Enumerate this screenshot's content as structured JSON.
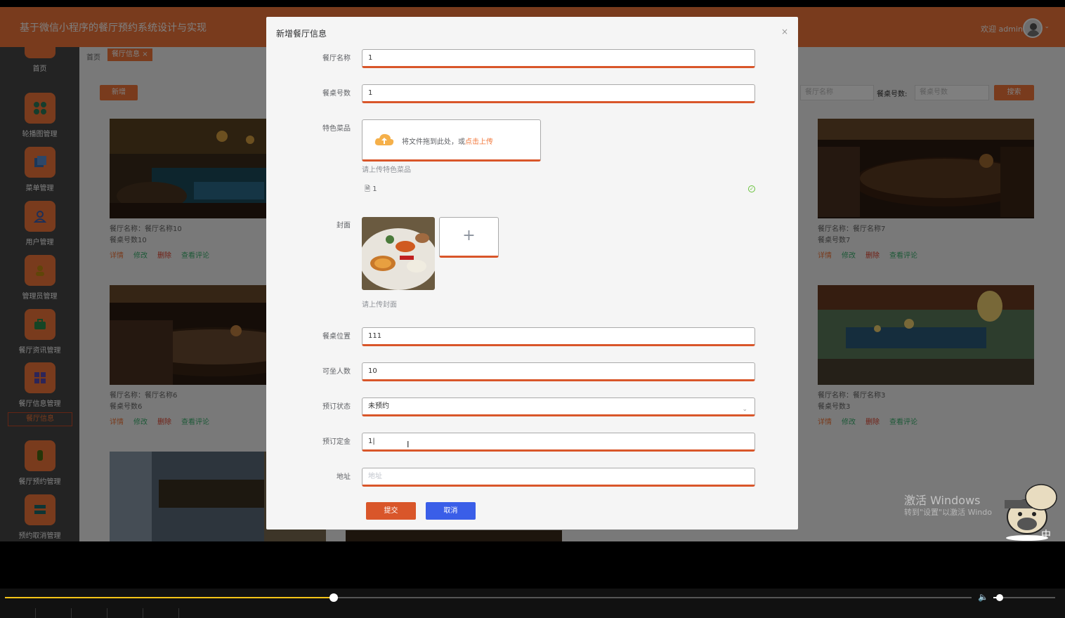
{
  "app": {
    "title": "基于微信小程序的餐厅预约系统设计与实现",
    "welcome": "欢迎 admin"
  },
  "sidebar": {
    "items": [
      {
        "label": "首页",
        "icon": "home-icon"
      },
      {
        "label": "轮播图管理",
        "icon": "grid-icon"
      },
      {
        "label": "菜单管理",
        "icon": "layers-icon"
      },
      {
        "label": "用户管理",
        "icon": "user-icon"
      },
      {
        "label": "管理员管理",
        "icon": "admin-icon"
      },
      {
        "label": "餐厅资讯管理",
        "icon": "briefcase-icon"
      },
      {
        "label": "餐厅信息管理",
        "icon": "windows-icon"
      },
      {
        "label": "餐厅预约管理",
        "icon": "phone-icon"
      },
      {
        "label": "预约取消管理",
        "icon": "list-icon"
      }
    ],
    "sub_active": "餐厅信息"
  },
  "breadcrumb": {
    "home": "首页",
    "active": "餐厅信息",
    "close": "×"
  },
  "toolbar": {
    "add_label": "新增",
    "search_name_placeholder": "餐厅名称",
    "search_table_label": "餐桌号数:",
    "search_table_placeholder": "餐桌号数",
    "search_label": "搜索"
  },
  "cards": [
    {
      "name": "餐厅名称：餐厅名称10",
      "table": "餐桌号数10"
    },
    {
      "name": "餐厅名称：餐厅名称7",
      "table": "餐桌号数7"
    },
    {
      "name": "餐厅名称：餐厅名称6",
      "table": "餐桌号数6"
    },
    {
      "name": "餐厅名称：餐厅名称3",
      "table": "餐桌号数3"
    }
  ],
  "card_actions": {
    "detail": "详情",
    "edit": "修改",
    "delete": "删除",
    "comments": "查看评论"
  },
  "modal": {
    "title": "新增餐厅信息",
    "close": "×",
    "fields": {
      "restaurant_name": {
        "label": "餐厅名称",
        "value": "1"
      },
      "table_number": {
        "label": "餐桌号数",
        "value": "1"
      },
      "featured_dishes": {
        "label": "特色菜品",
        "upload_text": "将文件拖到此处，或",
        "upload_link": "点击上传",
        "tip": "请上传特色菜品",
        "file_name": "1"
      },
      "cover": {
        "label": "封面",
        "tip": "请上传封面",
        "plus": "+"
      },
      "table_location": {
        "label": "餐桌位置",
        "value": "111"
      },
      "seats": {
        "label": "可坐人数",
        "value": "10"
      },
      "booking_status": {
        "label": "预订状态",
        "value": "未预约"
      },
      "deposit": {
        "label": "预订定金",
        "value": "1|"
      },
      "address": {
        "label": "地址",
        "placeholder": "地址"
      }
    },
    "submit_label": "提交",
    "cancel_label": "取消"
  },
  "watermark": {
    "line1": "激活 Windows",
    "line2": "转到\"设置\"以激活 Windo"
  },
  "player": {
    "progress": 0.34,
    "volume": 0.1
  },
  "colors": {
    "accent": "#f2773a",
    "sidebar": "#474747",
    "cancel": "#3a5ee8",
    "progress": "#f5c518"
  }
}
